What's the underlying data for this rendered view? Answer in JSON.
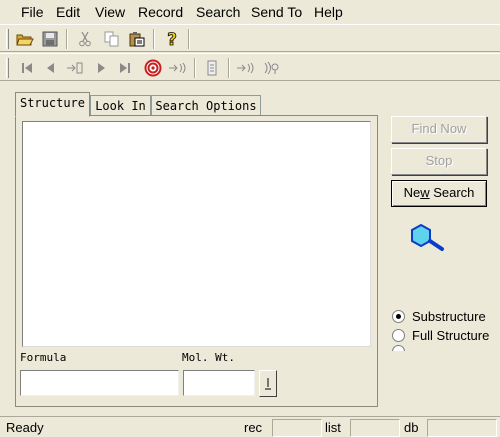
{
  "menu": {
    "file": "File",
    "edit": "Edit",
    "view": "View",
    "record": "Record",
    "search": "Search",
    "send_to": "Send To",
    "help": "Help"
  },
  "tabs": {
    "structure": "Structure",
    "look_in": "Look In",
    "search_options": "Search Options"
  },
  "fields": {
    "formula_label": "Formula",
    "formula_value": "",
    "mol_wt_label": "Mol. Wt.",
    "mol_wt_value": ""
  },
  "buttons": {
    "find_now": "Find Now",
    "stop": "Stop",
    "new_search_prefix": "Ne",
    "new_search_mnemonic": "w",
    "new_search_suffix": " Search"
  },
  "search_type": {
    "options": [
      "Substructure",
      "Full Structure"
    ],
    "selected": "Substructure"
  },
  "status": {
    "text": "Ready",
    "rec_label": "rec",
    "list_label": "list",
    "db_label": "db"
  },
  "colors": {
    "window_bg": "#ece9d8",
    "icon_cyan": "#5fd3ee",
    "icon_blue": "#0a3cc8",
    "target_red": "#c81e1e",
    "help_yellow": "#f5d200"
  },
  "icons": {
    "open": "open-folder-icon",
    "save": "save-icon",
    "cut": "cut-icon",
    "copy": "copy-icon",
    "paste": "paste-icon",
    "help": "help-icon",
    "first": "first-record-icon",
    "prev": "previous-record-icon",
    "goto": "go-to-record-icon",
    "next": "next-record-icon",
    "last": "last-record-icon",
    "target": "target-icon",
    "structure_tool": "cyclohexane-ring-icon"
  }
}
